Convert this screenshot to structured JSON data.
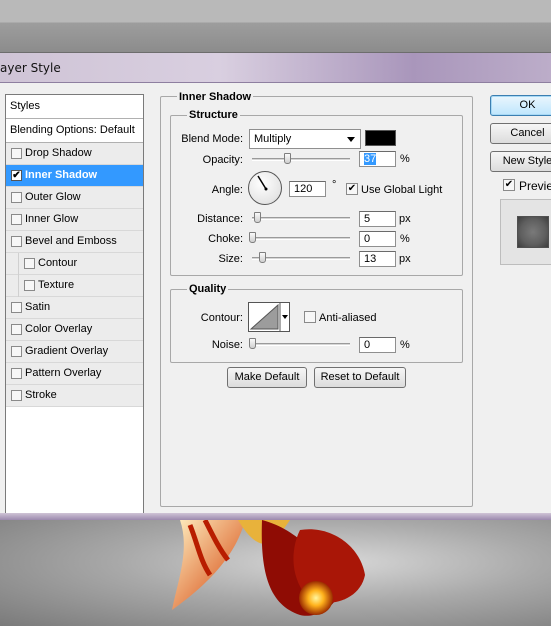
{
  "window": {
    "title": "ayer Style"
  },
  "styles_panel": {
    "header": "Styles",
    "blending_options": "Blending Options: Default",
    "effects": [
      {
        "label": "Drop Shadow",
        "checked": false,
        "active": false,
        "sub": false
      },
      {
        "label": "Inner Shadow",
        "checked": true,
        "active": true,
        "sub": false
      },
      {
        "label": "Outer Glow",
        "checked": false,
        "active": false,
        "sub": false
      },
      {
        "label": "Inner Glow",
        "checked": false,
        "active": false,
        "sub": false
      },
      {
        "label": "Bevel and Emboss",
        "checked": false,
        "active": false,
        "sub": false
      },
      {
        "label": "Contour",
        "checked": false,
        "active": false,
        "sub": true
      },
      {
        "label": "Texture",
        "checked": false,
        "active": false,
        "sub": true
      },
      {
        "label": "Satin",
        "checked": false,
        "active": false,
        "sub": false
      },
      {
        "label": "Color Overlay",
        "checked": false,
        "active": false,
        "sub": false
      },
      {
        "label": "Gradient Overlay",
        "checked": false,
        "active": false,
        "sub": false
      },
      {
        "label": "Pattern Overlay",
        "checked": false,
        "active": false,
        "sub": false
      },
      {
        "label": "Stroke",
        "checked": false,
        "active": false,
        "sub": false
      }
    ]
  },
  "inner_shadow": {
    "title": "Inner Shadow",
    "structure": {
      "title": "Structure",
      "blend_mode_label": "Blend Mode:",
      "blend_mode_value": "Multiply",
      "shadow_color": "#000000",
      "opacity_label": "Opacity:",
      "opacity_value": "37",
      "opacity_unit": "%",
      "opacity_fraction": 0.37,
      "angle_label": "Angle:",
      "angle_value": "120",
      "angle_unit": "°",
      "use_global_light_label": "Use Global Light",
      "use_global_light_checked": true,
      "distance_label": "Distance:",
      "distance_value": "5",
      "distance_unit": "px",
      "choke_label": "Choke:",
      "choke_value": "0",
      "choke_unit": "%",
      "size_label": "Size:",
      "size_value": "13",
      "size_unit": "px"
    },
    "quality": {
      "title": "Quality",
      "contour_label": "Contour:",
      "anti_aliased_label": "Anti-aliased",
      "anti_aliased_checked": false,
      "noise_label": "Noise:",
      "noise_value": "0",
      "noise_unit": "%"
    },
    "make_default_label": "Make Default",
    "reset_default_label": "Reset to Default"
  },
  "right_buttons": {
    "ok_label": "OK",
    "cancel_label": "Cancel",
    "new_style_label": "New Style",
    "preview_label": "Preview",
    "preview_checked": true
  },
  "colors": {
    "selection": "#3399ff",
    "title_gradient_start": "#cfc4d6",
    "title_gradient_end": "#a996bb"
  }
}
